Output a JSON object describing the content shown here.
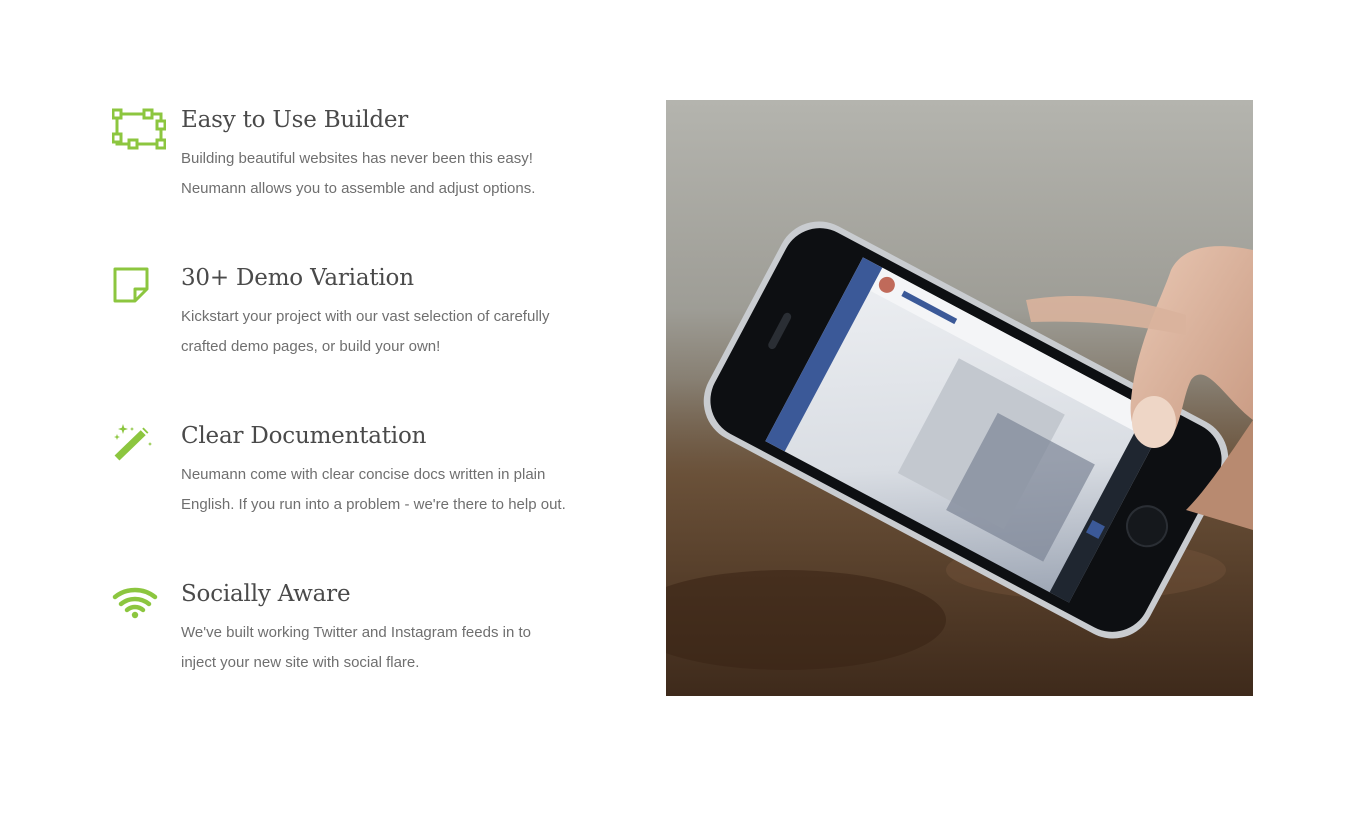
{
  "accent_color": "#8cc63f",
  "features": [
    {
      "icon": "builder-frame-icon",
      "title": "Easy to Use Builder",
      "line1": "Building beautiful websites has never been this easy!",
      "line2": "Neumann allows you to assemble and adjust options."
    },
    {
      "icon": "note-page-icon",
      "title": "30+ Demo Variation",
      "line1": "Kickstart your project with our vast selection of carefully",
      "line2": "crafted demo pages, or build your own!"
    },
    {
      "icon": "magic-wand-icon",
      "title": "Clear Documentation",
      "line1": "Neumann come with clear concise docs written in plain",
      "line2": "English. If you run into a problem - we're there to help out."
    },
    {
      "icon": "wifi-icon",
      "title": "Socially Aware",
      "line1": "We've built working Twitter and Instagram feeds in to",
      "line2": "inject your new site with social flare."
    }
  ],
  "photo": {
    "subject": "hand-holding-smartphone-photo"
  }
}
